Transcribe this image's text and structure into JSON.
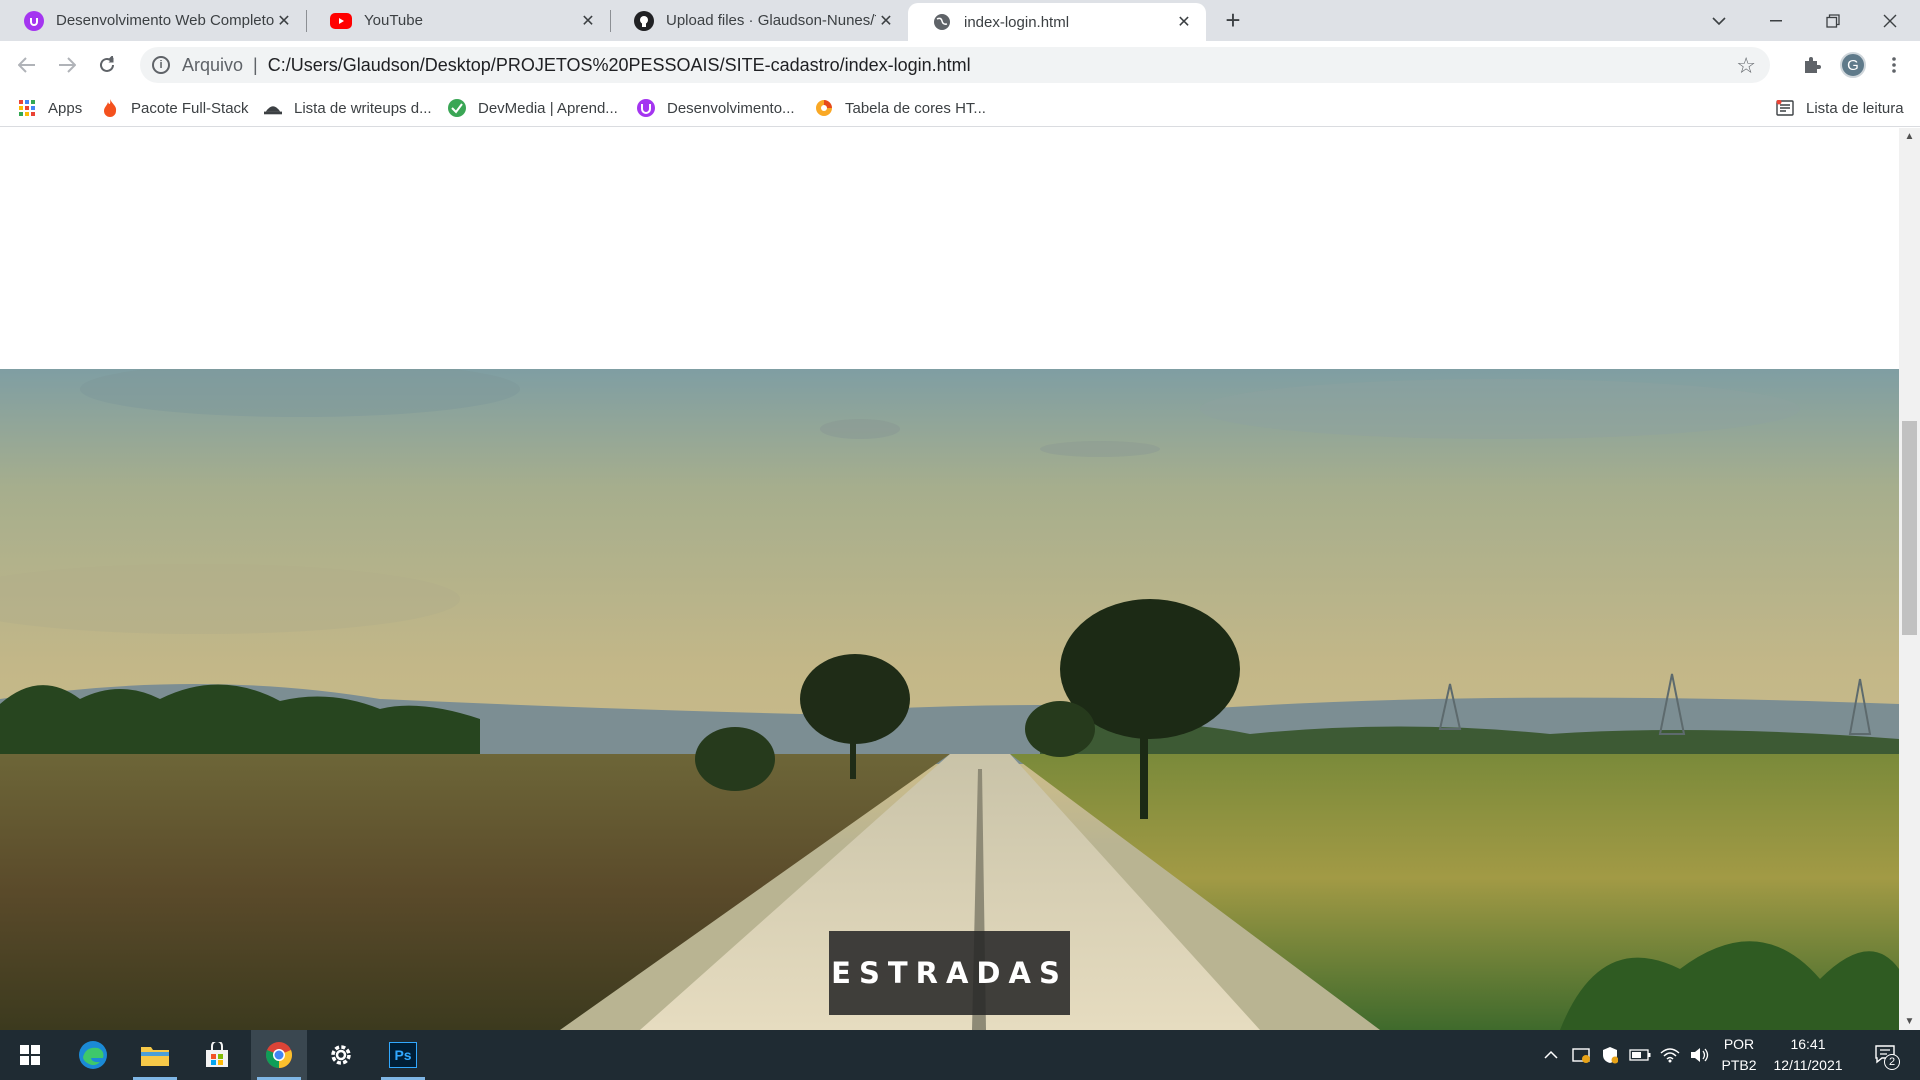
{
  "browser": {
    "tabs": [
      {
        "title": "Desenvolvimento Web Completo",
        "favicon": "udemy-icon",
        "color": "#a435f0"
      },
      {
        "title": "YouTube",
        "favicon": "youtube-icon",
        "color": "#ff0000"
      },
      {
        "title": "Upload files · Glaudson-Nunes/Tr",
        "favicon": "github-icon",
        "color": "#202124"
      },
      {
        "title": "index-login.html",
        "favicon": "globe-icon",
        "color": "#5f6368",
        "active": true
      }
    ],
    "address_bar": {
      "scheme_label": "Arquivo",
      "divider": "|",
      "url": "C:/Users/Glaudson/Desktop/PROJETOS%20PESSOAIS/SITE-cadastro/index-login.html"
    },
    "profile_initial": "G",
    "bookmarks": [
      {
        "label": "Apps",
        "icon": "apps-grid-icon"
      },
      {
        "label": "Pacote Full-Stack",
        "icon": "flame-icon"
      },
      {
        "label": "Lista de writeups d...",
        "icon": "hacker-icon"
      },
      {
        "label": "DevMedia | Aprend...",
        "icon": "devmedia-icon"
      },
      {
        "label": "Desenvolvimento...",
        "icon": "udemy-icon"
      },
      {
        "label": "Tabela de cores HT...",
        "icon": "color-table-icon"
      }
    ],
    "reading_list": "Lista de leitura"
  },
  "page": {
    "hero_label": "ESTRADAS",
    "hero_image": "country-road-landscape"
  },
  "taskbar": {
    "apps": [
      "windows-start-icon",
      "edge-icon",
      "file-explorer-icon",
      "store-icon",
      "chrome-icon",
      "settings-icon",
      "photoshop-icon"
    ],
    "photoshop_label": "Ps",
    "language": "POR",
    "layout": "PTB2",
    "time": "16:41",
    "date": "12/11/2021",
    "notifications": "2"
  }
}
